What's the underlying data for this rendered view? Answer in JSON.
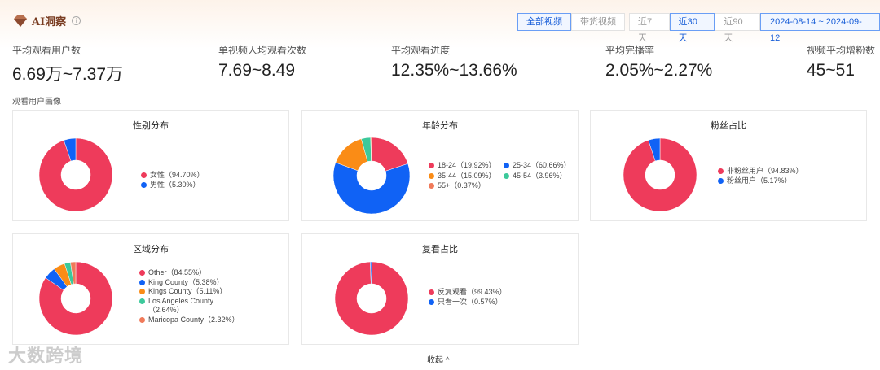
{
  "header": {
    "title": "AI洞察",
    "info_icon": "i"
  },
  "video_filter": [
    {
      "label": "全部视频",
      "active": true
    },
    {
      "label": "带货视频",
      "active": false
    }
  ],
  "period_filter": [
    {
      "label": "近7天",
      "active": false
    },
    {
      "label": "近30天",
      "active": true
    },
    {
      "label": "近90天",
      "active": false
    }
  ],
  "date_range": "2024-08-14 ~ 2024-09-12",
  "stats": [
    {
      "label": "平均观看用户数",
      "value": "6.69万~7.37万"
    },
    {
      "label": "单视频人均观看次数",
      "value": "7.69~8.49"
    },
    {
      "label": "平均观看进度",
      "value": "12.35%~13.66%"
    },
    {
      "label": "平均完播率",
      "value": "2.05%~2.27%"
    },
    {
      "label": "视频平均增粉数",
      "value": "45~51"
    }
  ],
  "section_title": "观看用户画像",
  "chart_data": [
    {
      "type": "pie",
      "title": "性别分布",
      "slices": [
        {
          "label": "女性（94.70%）",
          "value": 94.7,
          "color": "#ee3b5b"
        },
        {
          "label": "男性（5.30%）",
          "value": 5.3,
          "color": "#1062f5"
        }
      ]
    },
    {
      "type": "pie",
      "title": "年龄分布",
      "slices": [
        {
          "label": "18-24（19.92%）",
          "value": 19.92,
          "color": "#ee3b5b"
        },
        {
          "label": "25-34（60.66%）",
          "value": 60.66,
          "color": "#1062f5"
        },
        {
          "label": "35-44（15.09%）",
          "value": 15.09,
          "color": "#fa8c16"
        },
        {
          "label": "45-54（3.96%）",
          "value": 3.96,
          "color": "#3cc99b"
        },
        {
          "label": "55+（0.37%）",
          "value": 0.37,
          "color": "#f07a5a"
        }
      ]
    },
    {
      "type": "pie",
      "title": "粉丝占比",
      "slices": [
        {
          "label": "非粉丝用户（94.83%）",
          "value": 94.83,
          "color": "#ee3b5b"
        },
        {
          "label": "粉丝用户（5.17%）",
          "value": 5.17,
          "color": "#1062f5"
        }
      ]
    },
    {
      "type": "pie",
      "title": "区域分布",
      "slices": [
        {
          "label": "Other（84.55%）",
          "value": 84.55,
          "color": "#ee3b5b"
        },
        {
          "label": "King County（5.38%）",
          "value": 5.38,
          "color": "#1062f5"
        },
        {
          "label": "Kings County（5.11%）",
          "value": 5.11,
          "color": "#fa8c16"
        },
        {
          "label": "Los Angeles County（2.64%）",
          "value": 2.64,
          "color": "#3cc99b"
        },
        {
          "label": "Maricopa County（2.32%）",
          "value": 2.32,
          "color": "#f07a5a"
        }
      ]
    },
    {
      "type": "pie",
      "title": "复看占比",
      "slices": [
        {
          "label": "反复观看（99.43%）",
          "value": 99.43,
          "color": "#ee3b5b"
        },
        {
          "label": "只看一次（0.57%）",
          "value": 0.57,
          "color": "#1062f5"
        }
      ]
    }
  ],
  "watermark": "大数跨境",
  "collapse_label": "收起 ^"
}
